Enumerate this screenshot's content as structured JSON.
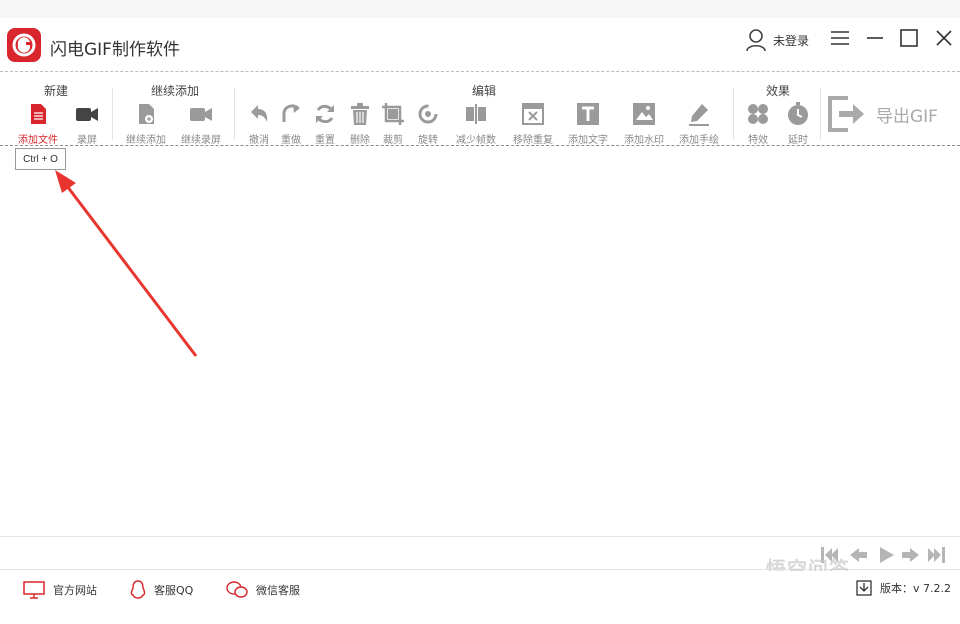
{
  "app": {
    "title": "闪电GIF制作软件"
  },
  "header": {
    "user_label": "未登录"
  },
  "toolbar": {
    "groups": [
      {
        "title": "新建"
      },
      {
        "title": "继续添加"
      },
      {
        "title": "编辑"
      },
      {
        "title": "效果"
      }
    ],
    "tools": [
      {
        "label": "添加文件",
        "icon": "file-add-icon"
      },
      {
        "label": "录屏",
        "icon": "video-camera-icon"
      },
      {
        "label": "继续添加",
        "icon": "file-continue-icon"
      },
      {
        "label": "继续录屏",
        "icon": "video-camera-continue-icon"
      },
      {
        "label": "撤消",
        "icon": "undo-icon"
      },
      {
        "label": "重做",
        "icon": "redo-icon"
      },
      {
        "label": "重置",
        "icon": "reset-icon"
      },
      {
        "label": "删除",
        "icon": "trash-icon"
      },
      {
        "label": "裁剪",
        "icon": "crop-icon"
      },
      {
        "label": "旋转",
        "icon": "rotate-icon"
      },
      {
        "label": "减少帧数",
        "icon": "reduce-frames-icon"
      },
      {
        "label": "移除重复",
        "icon": "remove-duplicate-icon"
      },
      {
        "label": "添加文字",
        "icon": "text-icon"
      },
      {
        "label": "添加水印",
        "icon": "watermark-icon"
      },
      {
        "label": "添加手绘",
        "icon": "pen-icon"
      },
      {
        "label": "特效",
        "icon": "effects-icon"
      },
      {
        "label": "延时",
        "icon": "clock-icon"
      }
    ],
    "export_label": "导出GIF"
  },
  "tooltip": {
    "text": "Ctrl + O"
  },
  "statusbar": {
    "website_label": "官方网站",
    "qq_label": "客服QQ",
    "wechat_label": "微信客服",
    "version_label": "版本：v 7.2.2"
  },
  "watermark": {
    "text": "悟空问答"
  },
  "colors": {
    "accent": "#d8262c",
    "icon_gray": "#9a9a9a"
  }
}
